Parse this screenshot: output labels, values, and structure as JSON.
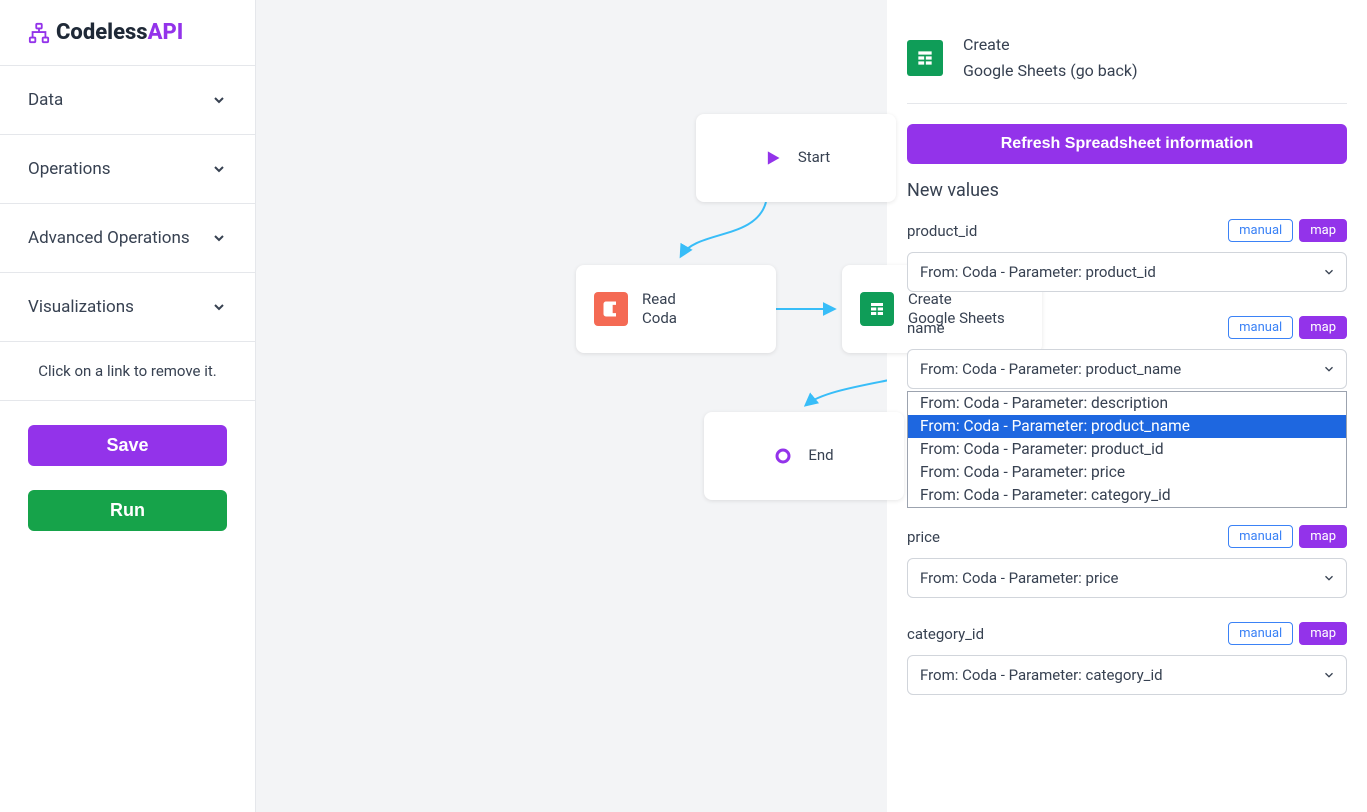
{
  "logo": {
    "text1": "Codeless",
    "text2": "API"
  },
  "sidebar": {
    "menu": [
      {
        "label": "Data"
      },
      {
        "label": "Operations"
      },
      {
        "label": "Advanced Operations"
      },
      {
        "label": "Visualizations"
      }
    ],
    "hint": "Click on a link to remove it.",
    "save": "Save",
    "run": "Run"
  },
  "canvas": {
    "nodes": {
      "start": {
        "label": "Start"
      },
      "read": {
        "line1": "Read",
        "line2": "Coda"
      },
      "create": {
        "line1": "Create",
        "line2": "Google Sheets"
      },
      "end": {
        "label": "End"
      }
    }
  },
  "panel": {
    "header": {
      "title": "Create",
      "source": "Google Sheets",
      "goback": "(go back)"
    },
    "refresh": "Refresh Spreadsheet information",
    "section_title": "New values",
    "toggles": {
      "manual": "manual",
      "map": "map"
    },
    "fields": [
      {
        "label": "product_id",
        "value": "From: Coda - Parameter: product_id"
      },
      {
        "label": "name",
        "value": "From: Coda - Parameter: product_name"
      },
      {
        "label": "price",
        "value": "From: Coda - Parameter: price"
      },
      {
        "label": "category_id",
        "value": "From: Coda - Parameter: category_id"
      }
    ],
    "dropdown": {
      "options": [
        "From: Coda - Parameter: description",
        "From: Coda - Parameter: product_name",
        "From: Coda - Parameter: product_id",
        "From: Coda - Parameter: price",
        "From: Coda - Parameter: category_id"
      ],
      "selected_index": 1
    }
  }
}
